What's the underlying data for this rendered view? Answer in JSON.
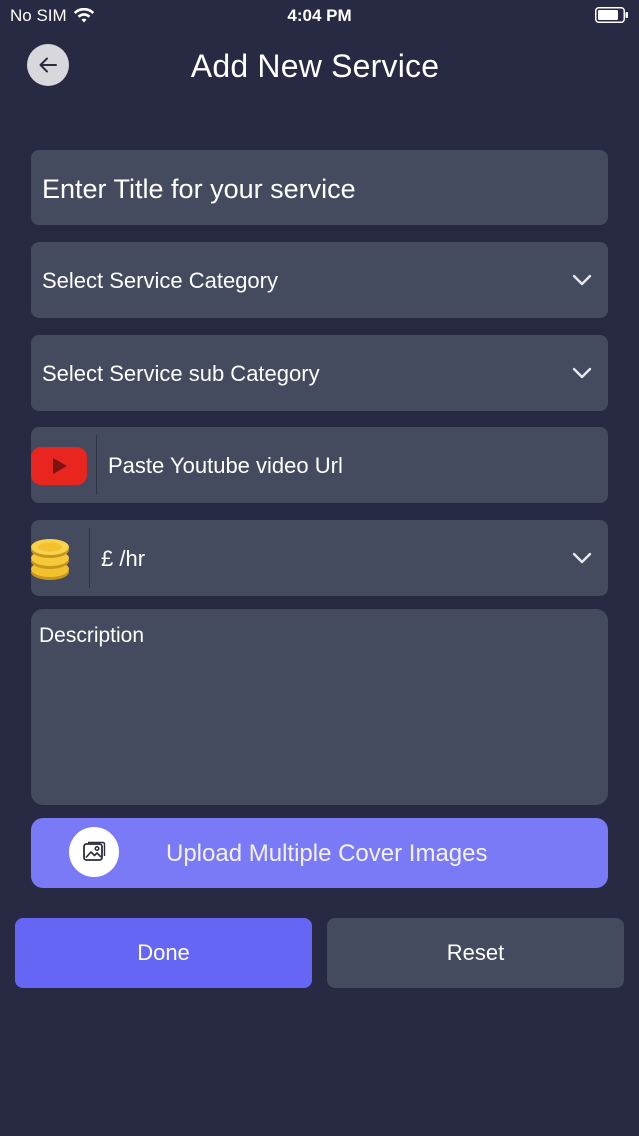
{
  "status_bar": {
    "carrier": "No SIM",
    "time": "4:04 PM"
  },
  "header": {
    "title": "Add New Service"
  },
  "form": {
    "title_placeholder": "Enter Title for your service",
    "category_placeholder": "Select Service Category",
    "subcategory_placeholder": "Select Service sub Category",
    "youtube_placeholder": "Paste Youtube video Url",
    "rate_value": "£ /hr",
    "description_placeholder": "Description"
  },
  "upload": {
    "label": "Upload Multiple Cover Images"
  },
  "actions": {
    "done_label": "Done",
    "reset_label": "Reset"
  },
  "colors": {
    "background": "#272a42",
    "field": "#444b5e",
    "accent": "#6666f5",
    "upload": "#7a7af7",
    "youtube_red": "#e8251f",
    "coin_gold": "#f2c12e"
  },
  "icons": {
    "back": "arrow-left-icon",
    "chevron": "chevron-down-icon",
    "youtube": "youtube-icon",
    "coins": "coins-icon",
    "image": "image-icon",
    "wifi": "wifi-icon",
    "battery": "battery-icon"
  }
}
